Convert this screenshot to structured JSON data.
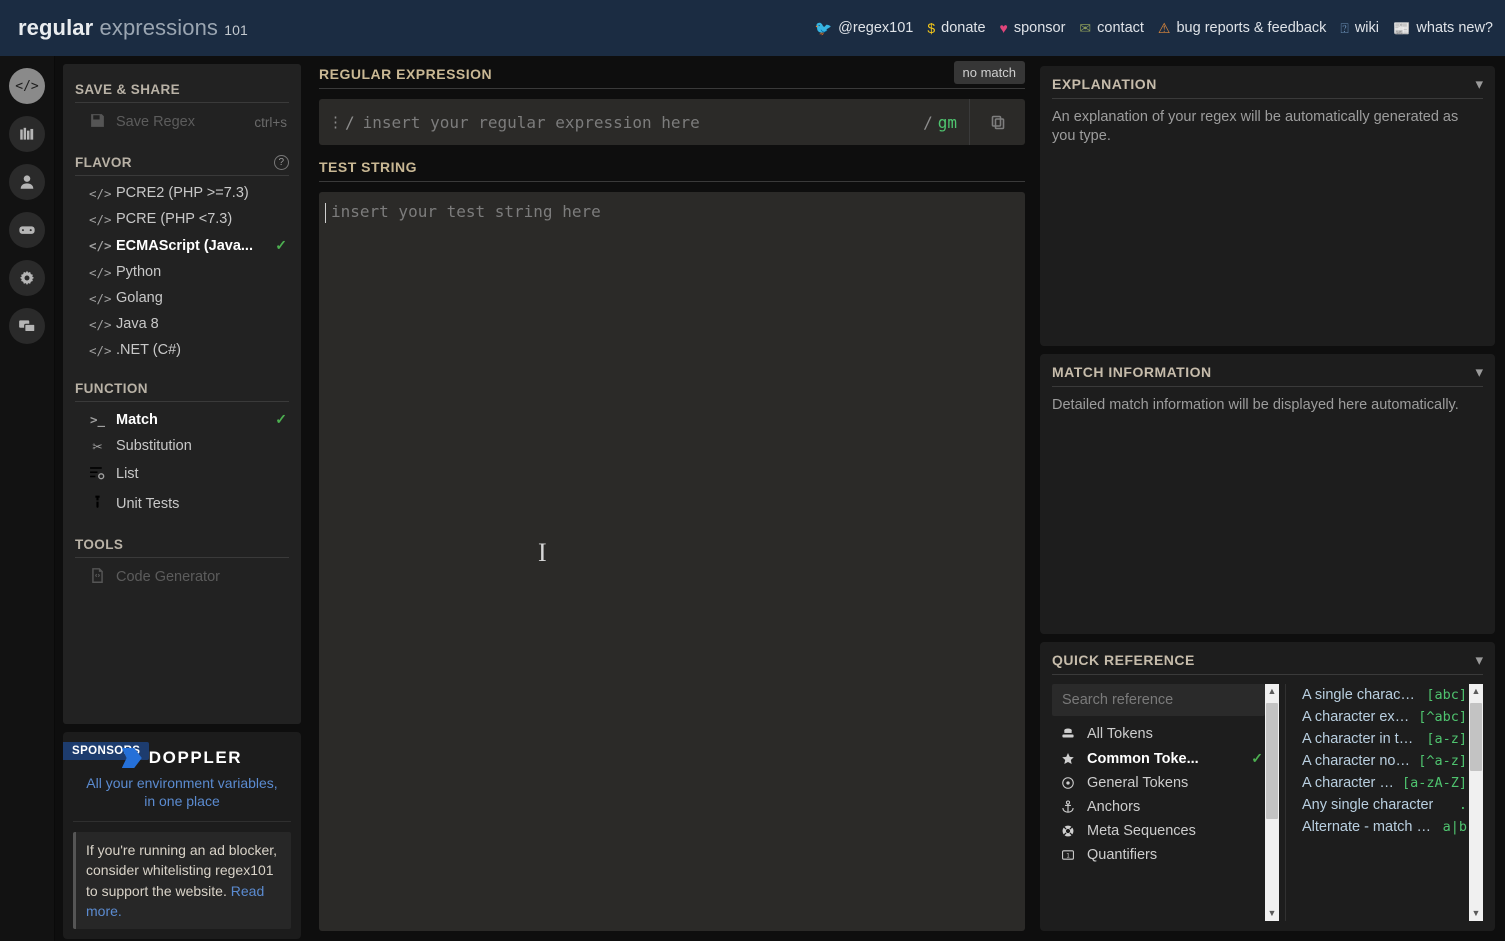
{
  "header": {
    "logo_bold": "regular",
    "logo_light": "expressions",
    "logo_num": "101",
    "nav": [
      {
        "icon": "twitter-icon",
        "glyph": "🐦",
        "label": "@regex101",
        "color": "#1da1f2"
      },
      {
        "icon": "dollar-icon",
        "glyph": "$",
        "label": "donate",
        "color": "#f0c419"
      },
      {
        "icon": "heart-icon",
        "glyph": "♥",
        "label": "sponsor",
        "color": "#e0457b"
      },
      {
        "icon": "mail-icon",
        "glyph": "✉",
        "label": "contact",
        "color": "#8a9a5b"
      },
      {
        "icon": "warning-icon",
        "glyph": "⚠",
        "label": "bug reports & feedback",
        "color": "#e08a3c"
      },
      {
        "icon": "wiki-icon",
        "glyph": "⍰",
        "label": "wiki",
        "color": "#6b8fb5"
      },
      {
        "icon": "news-icon",
        "glyph": "📰",
        "label": "whats new?",
        "color": "#e0a83c"
      }
    ]
  },
  "rail": [
    {
      "name": "sidebar-icon-code",
      "glyph": "</>",
      "active": true
    },
    {
      "name": "sidebar-icon-library",
      "glyph": "library",
      "active": false
    },
    {
      "name": "sidebar-icon-account",
      "glyph": "person",
      "active": false
    },
    {
      "name": "sidebar-icon-sponsor-game",
      "glyph": "gamepad",
      "active": false
    },
    {
      "name": "sidebar-icon-settings",
      "glyph": "gear",
      "active": false
    },
    {
      "name": "sidebar-icon-community",
      "glyph": "chat",
      "active": false
    }
  ],
  "left": {
    "save_share": {
      "title": "SAVE & SHARE",
      "items": [
        {
          "icon": "save-icon",
          "label": "Save Regex",
          "shortcut": "ctrl+s",
          "disabled": true
        }
      ]
    },
    "flavor": {
      "title": "FLAVOR",
      "help_icon": "question-mark-icon",
      "items": [
        {
          "label": "PCRE2 (PHP >=7.3)",
          "selected": false
        },
        {
          "label": "PCRE (PHP <7.3)",
          "selected": false
        },
        {
          "label": "ECMAScript (Java...",
          "selected": true
        },
        {
          "label": "Python",
          "selected": false
        },
        {
          "label": "Golang",
          "selected": false
        },
        {
          "label": "Java 8",
          "selected": false
        },
        {
          "label": ".NET (C#)",
          "selected": false
        }
      ]
    },
    "function": {
      "title": "FUNCTION",
      "items": [
        {
          "icon": "terminal-icon",
          "glyph": ">_",
          "label": "Match",
          "selected": true
        },
        {
          "icon": "scissors-icon",
          "glyph": "✂",
          "label": "Substitution",
          "selected": false
        },
        {
          "icon": "list-icon",
          "glyph": "list",
          "label": "List",
          "selected": false
        },
        {
          "icon": "testtube-icon",
          "glyph": "tube",
          "label": "Unit Tests",
          "selected": false
        }
      ]
    },
    "tools": {
      "title": "TOOLS",
      "items": [
        {
          "icon": "code-file-icon",
          "label": "Code Generator",
          "disabled": true
        }
      ]
    },
    "sponsor": {
      "tag": "SPONSORS",
      "brand": "DOPPLER",
      "tagline": "All your environment variables, in one place",
      "adblock_text": "If you're running an ad blocker, consider whitelisting regex101 to support the website. ",
      "adblock_link": "Read more."
    }
  },
  "center": {
    "regex_title": "REGULAR EXPRESSION",
    "match_status": "no match",
    "regex_value": "",
    "regex_placeholder": "insert your regular expression here",
    "delimiter_open": "/",
    "delimiter_close": "/",
    "flags": "gm",
    "copy_icon": "copy-icon",
    "test_title": "TEST STRING",
    "test_value": "",
    "test_placeholder": "insert your test string here"
  },
  "right": {
    "explanation": {
      "title": "EXPLANATION",
      "body": "An explanation of your regex will be automatically generated as you type."
    },
    "match_information": {
      "title": "MATCH INFORMATION",
      "body": "Detailed match information will be displayed here automatically."
    },
    "quick_reference": {
      "title": "QUICK REFERENCE",
      "search_placeholder": "Search reference",
      "categories": [
        {
          "icon": "database-icon",
          "label": "All Tokens",
          "selected": false
        },
        {
          "icon": "star-icon",
          "label": "Common Toke...",
          "selected": true
        },
        {
          "icon": "dot-circle-icon",
          "label": "General Tokens",
          "selected": false
        },
        {
          "icon": "anchor-icon",
          "label": "Anchors",
          "selected": false
        },
        {
          "icon": "lifering-icon",
          "label": "Meta Sequences",
          "selected": false
        },
        {
          "icon": "quantifier-icon",
          "label": "Quantifiers",
          "selected": false
        }
      ],
      "tokens": [
        {
          "desc": "A single characte...",
          "code": "[abc]"
        },
        {
          "desc": "A character exc...",
          "code": "[^abc]"
        },
        {
          "desc": "A character in th...",
          "code": "[a-z]"
        },
        {
          "desc": "A character not...",
          "code": "[^a-z]"
        },
        {
          "desc": "A character i...",
          "code": "[a-zA-Z]"
        },
        {
          "desc": "Any single character",
          "code": "."
        },
        {
          "desc": "Alternate - match e...",
          "code": "a|b"
        }
      ]
    }
  },
  "colors": {
    "header_bg": "#1b2c42",
    "accent_green": "#4fc46f",
    "section_label": "#c9b894",
    "link_blue": "#5b8bd0",
    "panel_bg": "#222222",
    "editor_bg": "#2b2a28"
  }
}
